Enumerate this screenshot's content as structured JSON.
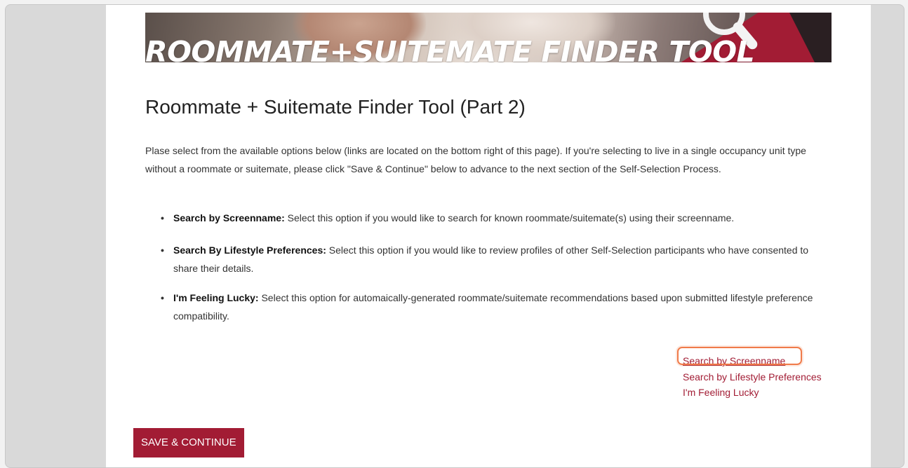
{
  "banner": {
    "title": "ROOMMATE+SUITEMATE  FINDER TOOL"
  },
  "page": {
    "title": "Roommate + Suitemate Finder Tool (Part 2)",
    "intro": "Plase select from the available options below (links are located on the bottom right of this page). If you're selecting to live in a single occupancy unit type without a roommate or suitemate, please click \"Save & Continue\" below to advance to the next section of the Self-Selection Process."
  },
  "options": [
    {
      "term": "Search by Screenname:",
      "description": "Select this option if you would like to search for known roommate/suitemate(s) using their screenname."
    },
    {
      "term": "Search By Lifestyle Preferences:",
      "description": "Select this option if you would like to review profiles of other Self-Selection participants who have consented to share their details."
    },
    {
      "term": "I'm Feeling Lucky:",
      "description": "Select this option for automaically-generated roommate/suitemate recommendations based upon submitted lifestyle preference compatibility."
    }
  ],
  "links": [
    "Search by Screenname",
    "Search by Lifestyle Preferences",
    "I'm Feeling Lucky"
  ],
  "buttons": {
    "save_continue": "SAVE & CONTINUE"
  },
  "colors": {
    "brand": "#a21c34",
    "highlight": "#f07b4a"
  }
}
